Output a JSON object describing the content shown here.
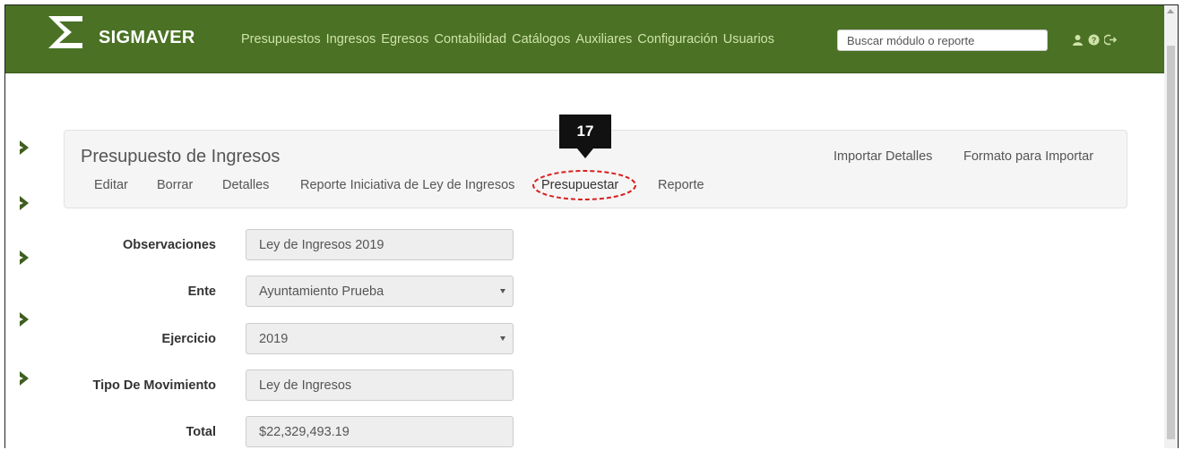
{
  "header": {
    "brand": "SIGMAVER",
    "menu": [
      "Presupuestos",
      "Ingresos",
      "Egresos",
      "Contabilidad",
      "Catálogos",
      "Auxiliares",
      "Configuración",
      "Usuarios"
    ],
    "search_placeholder": "Buscar módulo o reporte",
    "icons": [
      "user-icon",
      "help-icon",
      "logout-icon"
    ]
  },
  "sidebar": {
    "icons": [
      "chevron-right-icon",
      "chevron-right-icon",
      "chevron-right-icon",
      "chevron-right-icon",
      "chevron-right-icon"
    ]
  },
  "panel": {
    "title": "Presupuesto de Ingresos",
    "right_links": [
      "Importar Detalles",
      "Formato para Importar"
    ],
    "subnav": [
      "Editar",
      "Borrar",
      "Detalles",
      "Reporte Iniciativa de Ley de Ingresos",
      "Presupuestar",
      "Reporte"
    ]
  },
  "callout": {
    "number": "17",
    "color": "#111111",
    "highlight_color": "#d9211f"
  },
  "form": {
    "fields": [
      {
        "label": "Observaciones",
        "value": "Ley de Ingresos 2019"
      },
      {
        "label": "Ente",
        "value": "Ayuntamiento Prueba"
      },
      {
        "label": "Ejercicio",
        "value": "2019"
      },
      {
        "label": "Tipo De Movimiento",
        "value": "Ley de Ingresos"
      },
      {
        "label": "Total",
        "value": "$22,329,493.19"
      }
    ]
  },
  "colors": {
    "navbar": "#4a7124",
    "menu_link": "#cfe3a8",
    "chevron": "#3f5f1f"
  }
}
